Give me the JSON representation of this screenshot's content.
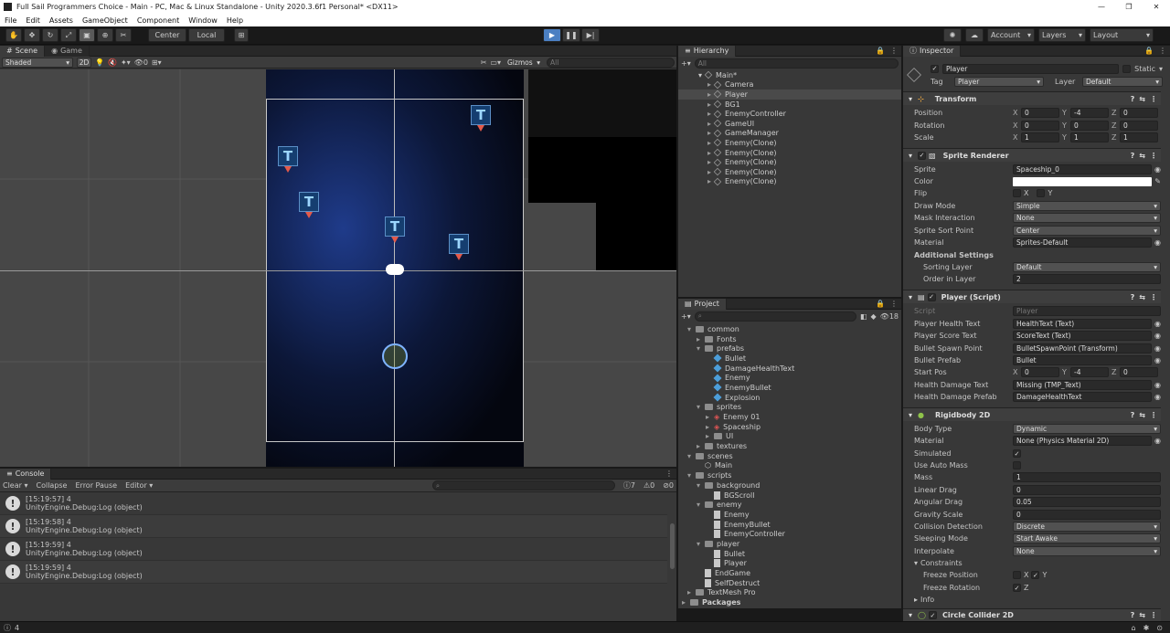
{
  "window": {
    "title": "Full Sail Programmers Choice - Main - PC, Mac & Linux Standalone - Unity 2020.3.6f1 Personal* <DX11>"
  },
  "menu": [
    "File",
    "Edit",
    "Assets",
    "GameObject",
    "Component",
    "Window",
    "Help"
  ],
  "toolbar": {
    "center": "Center",
    "local": "Local",
    "account": "Account",
    "layers": "Layers",
    "layout": "Layout"
  },
  "scene": {
    "tab_scene": "Scene",
    "tab_game": "Game",
    "shading": "Shaded",
    "mode2d": "2D",
    "gizmos": "Gizmos",
    "search": "All",
    "zero": "0"
  },
  "hierarchy": {
    "tab": "Hierarchy",
    "search": "All",
    "root": "Main*",
    "items": [
      "Camera",
      "Player",
      "BG1",
      "EnemyController",
      "GameUI",
      "GameManager",
      "Enemy(Clone)",
      "Enemy(Clone)",
      "Enemy(Clone)",
      "Enemy(Clone)",
      "Enemy(Clone)"
    ]
  },
  "project": {
    "tab": "Project",
    "count": "18",
    "items": [
      {
        "label": "common",
        "d": 0,
        "t": "folder",
        "a": "v"
      },
      {
        "label": "Fonts",
        "d": 1,
        "t": "folder",
        "a": ">"
      },
      {
        "label": "prefabs",
        "d": 1,
        "t": "folder",
        "a": "v"
      },
      {
        "label": "Bullet",
        "d": 2,
        "t": "prefab"
      },
      {
        "label": "DamageHealthText",
        "d": 2,
        "t": "prefab"
      },
      {
        "label": "Enemy",
        "d": 2,
        "t": "prefab"
      },
      {
        "label": "EnemyBullet",
        "d": 2,
        "t": "prefab"
      },
      {
        "label": "Explosion",
        "d": 2,
        "t": "prefab"
      },
      {
        "label": "sprites",
        "d": 1,
        "t": "folder",
        "a": "v"
      },
      {
        "label": "Enemy 01",
        "d": 2,
        "t": "sprite",
        "a": ">"
      },
      {
        "label": "Spaceship",
        "d": 2,
        "t": "sprite",
        "a": ">"
      },
      {
        "label": "UI",
        "d": 2,
        "t": "folder",
        "a": ">"
      },
      {
        "label": "textures",
        "d": 1,
        "t": "folder",
        "a": ">"
      },
      {
        "label": "scenes",
        "d": 0,
        "t": "folder",
        "a": "v"
      },
      {
        "label": "Main",
        "d": 1,
        "t": "scene"
      },
      {
        "label": "scripts",
        "d": 0,
        "t": "folder",
        "a": "v"
      },
      {
        "label": "background",
        "d": 1,
        "t": "folder",
        "a": "v"
      },
      {
        "label": "BGScroll",
        "d": 2,
        "t": "file"
      },
      {
        "label": "enemy",
        "d": 1,
        "t": "folder",
        "a": "v"
      },
      {
        "label": "Enemy",
        "d": 2,
        "t": "file"
      },
      {
        "label": "EnemyBullet",
        "d": 2,
        "t": "file"
      },
      {
        "label": "EnemyController",
        "d": 2,
        "t": "file"
      },
      {
        "label": "player",
        "d": 1,
        "t": "folder",
        "a": "v"
      },
      {
        "label": "Bullet",
        "d": 2,
        "t": "file"
      },
      {
        "label": "Player",
        "d": 2,
        "t": "file"
      },
      {
        "label": "EndGame",
        "d": 1,
        "t": "file"
      },
      {
        "label": "SelfDestruct",
        "d": 1,
        "t": "file"
      },
      {
        "label": "TextMesh Pro",
        "d": 0,
        "t": "folder",
        "a": ">"
      },
      {
        "label": "Packages",
        "d": -1,
        "t": "folder",
        "a": ">"
      }
    ]
  },
  "inspector": {
    "tab": "Inspector",
    "object": "Player",
    "static": "Static",
    "tag_label": "Tag",
    "tag": "Player",
    "layer_label": "Layer",
    "layer": "Default",
    "transform": {
      "title": "Transform",
      "position": "Position",
      "rotation": "Rotation",
      "scale": "Scale",
      "pos": [
        "0",
        "-4",
        "0"
      ],
      "rot": [
        "0",
        "0",
        "0"
      ],
      "scl": [
        "1",
        "1",
        "1"
      ]
    },
    "sprite": {
      "title": "Sprite Renderer",
      "sprite_l": "Sprite",
      "sprite": "Spaceship_0",
      "color_l": "Color",
      "flip_l": "Flip",
      "flip_x": "X",
      "flip_y": "Y",
      "draw_l": "Draw Mode",
      "draw": "Simple",
      "mask_l": "Mask Interaction",
      "mask": "None",
      "sort_l": "Sprite Sort Point",
      "sort": "Center",
      "mat_l": "Material",
      "mat": "Sprites-Default",
      "add": "Additional Settings",
      "layer_l": "Sorting Layer",
      "layer": "Default",
      "order_l": "Order in Layer",
      "order": "2"
    },
    "player": {
      "title": "Player (Script)",
      "script_l": "Script",
      "script": "Player",
      "health_l": "Player Health Text",
      "health": "HealthText (Text)",
      "score_l": "Player Score Text",
      "score": "ScoreText (Text)",
      "spawn_l": "Bullet Spawn Point",
      "spawn": "BulletSpawnPoint (Transform)",
      "prefab_l": "Bullet Prefab",
      "prefab": "Bullet",
      "start_l": "Start Pos",
      "start": [
        "0",
        "-4",
        "0"
      ],
      "dmg_l": "Health Damage Text",
      "dmg": "Missing (TMP_Text)",
      "dmgp_l": "Health Damage Prefab",
      "dmgp": "DamageHealthText"
    },
    "rb": {
      "title": "Rigidbody 2D",
      "body_l": "Body Type",
      "body": "Dynamic",
      "mat_l": "Material",
      "mat": "None (Physics Material 2D)",
      "sim_l": "Simulated",
      "auto_l": "Use Auto Mass",
      "mass_l": "Mass",
      "mass": "1",
      "ld_l": "Linear Drag",
      "ld": "0",
      "ad_l": "Angular Drag",
      "ad": "0.05",
      "gs_l": "Gravity Scale",
      "gs": "0",
      "cd_l": "Collision Detection",
      "cd": "Discrete",
      "sm_l": "Sleeping Mode",
      "sm": "Start Awake",
      "int_l": "Interpolate",
      "int": "None",
      "con_l": "Constraints",
      "fp_l": "Freeze Position",
      "fr_l": "Freeze Rotation",
      "x": "X",
      "y": "Y",
      "z": "Z",
      "info": "Info"
    },
    "collider": {
      "title": "Circle Collider 2D"
    }
  },
  "console": {
    "tab": "Console",
    "clear": "Clear",
    "collapse": "Collapse",
    "error_pause": "Error Pause",
    "editor": "Editor",
    "count_info": "7",
    "count_warn": "0",
    "count_err": "0",
    "rows": [
      {
        "t": "[15:19:57] 4",
        "s": "UnityEngine.Debug:Log (object)"
      },
      {
        "t": "[15:19:58] 4",
        "s": "UnityEngine.Debug:Log (object)"
      },
      {
        "t": "[15:19:59] 4",
        "s": "UnityEngine.Debug:Log (object)"
      },
      {
        "t": "[15:19:59] 4",
        "s": "UnityEngine.Debug:Log (object)"
      }
    ]
  },
  "status": {
    "text": "4"
  }
}
